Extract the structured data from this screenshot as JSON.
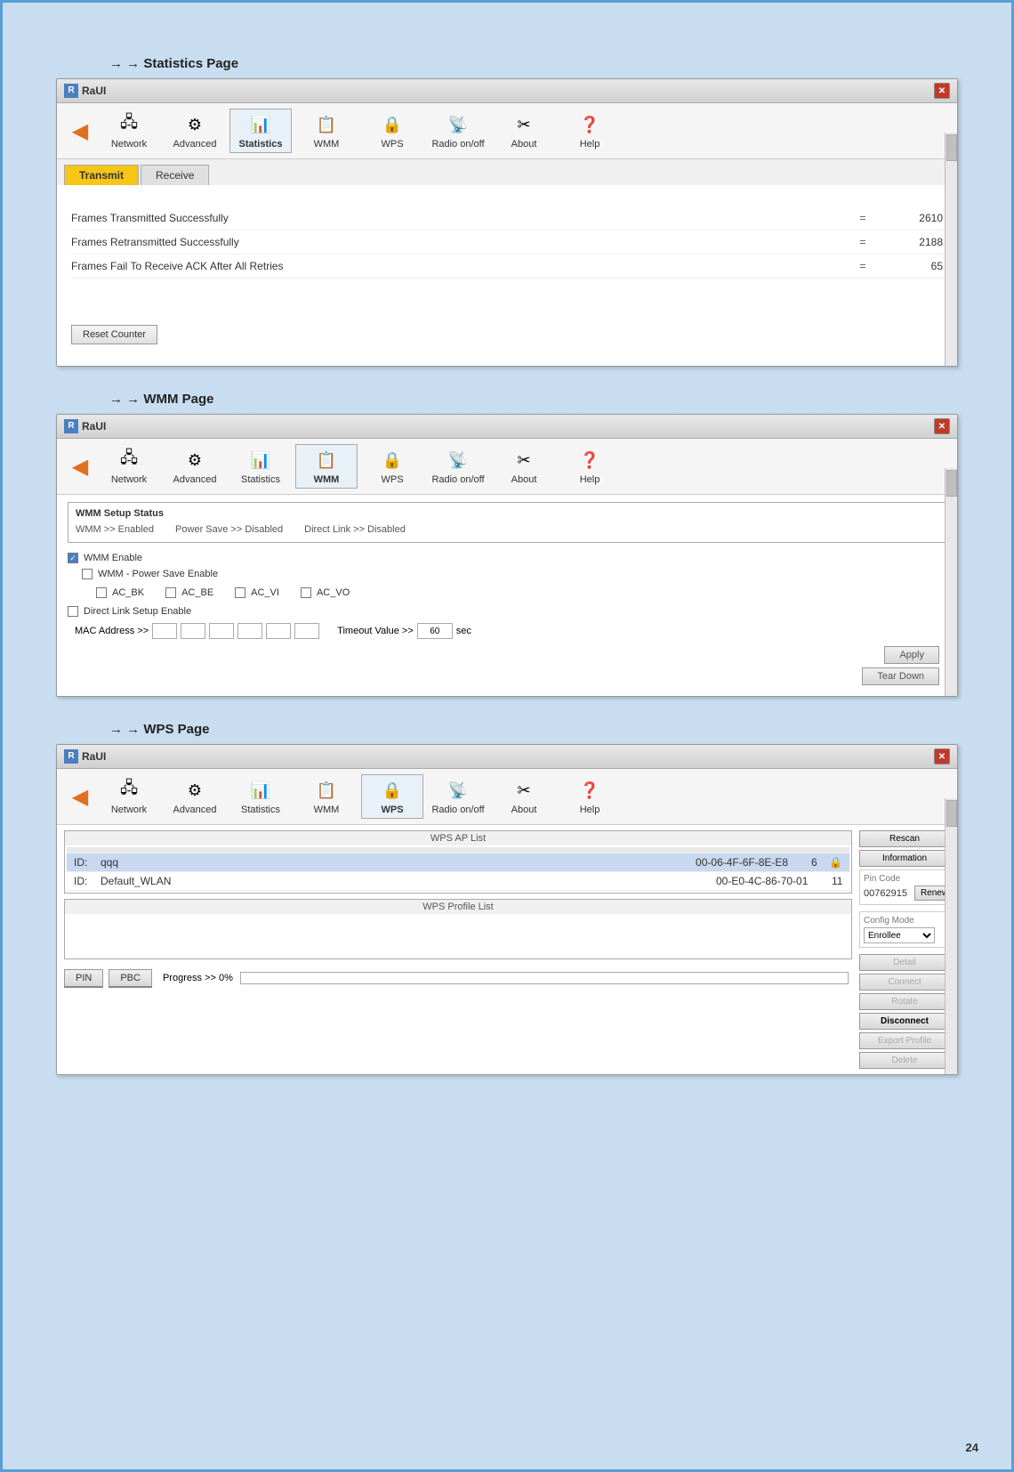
{
  "page": {
    "number": "24",
    "background_color": "#c8ddf0"
  },
  "sections": [
    {
      "id": "statistics",
      "header": "→ Statistics Page",
      "window": {
        "title": "RaUI",
        "tabs": [
          "Transmit",
          "Receive"
        ],
        "active_tab": "Transmit",
        "stats": [
          {
            "label": "Frames Transmitted Successfully",
            "eq": "=",
            "value": "2610"
          },
          {
            "label": "Frames Retransmitted Successfully",
            "eq": "=",
            "value": "2188"
          },
          {
            "label": "Frames Fail To Receive ACK After All Retries",
            "eq": "=",
            "value": "65"
          }
        ],
        "reset_btn": "Reset Counter"
      }
    },
    {
      "id": "wmm",
      "header": "→ WMM Page",
      "window": {
        "title": "RaUI",
        "wmm_status": {
          "enabled": "WMM >> Enabled",
          "power_save": "Power Save >> Disabled",
          "direct_link": "Direct Link >> Disabled"
        },
        "wmm_enable_label": "WMM Enable",
        "wmm_power_save_label": "WMM - Power Save Enable",
        "ac_options": [
          "AC_BK",
          "AC_BE",
          "AC_VI",
          "AC_VO"
        ],
        "direct_link_label": "Direct Link Setup Enable",
        "mac_label": "MAC Address >>",
        "timeout_label": "Timeout Value >>",
        "timeout_value": "60",
        "timeout_unit": "sec",
        "apply_btn": "Apply",
        "tear_down_btn": "Tear Down"
      }
    },
    {
      "id": "wps",
      "header": "→ WPS Page",
      "window": {
        "title": "RaUI",
        "ap_list_title": "WPS AP List",
        "ap_rows": [
          {
            "id_label": "ID:",
            "name": "qqq",
            "mac": "00-06-4F-6F-8E-E8",
            "channel": "6"
          },
          {
            "id_label": "ID:",
            "name": "Default_WLAN",
            "mac": "00-E0-4C-86-70-01",
            "channel": "11"
          }
        ],
        "profile_list_title": "WPS Profile List",
        "right_buttons": [
          "Rescan",
          "Information"
        ],
        "pin_code_label": "Pin Code",
        "pin_code_value": "00762915",
        "renew_btn": "Renew",
        "config_mode_label": "Config Mode",
        "config_mode_value": "Enrollee",
        "action_buttons": [
          "Detail",
          "Connect",
          "Rotate",
          "Disconnect",
          "Export Profile",
          "Delete"
        ],
        "pin_btn": "PIN",
        "pbc_btn": "PBC",
        "progress_label": "Progress >> 0%"
      }
    }
  ],
  "toolbar": {
    "items": [
      {
        "id": "network",
        "label": "Network",
        "icon": "🖧"
      },
      {
        "id": "advanced",
        "label": "Advanced",
        "icon": "⚙"
      },
      {
        "id": "statistics",
        "label": "Statistics",
        "icon": "📊"
      },
      {
        "id": "wmm",
        "label": "WMM",
        "icon": "📋"
      },
      {
        "id": "wps",
        "label": "WPS",
        "icon": "🔒"
      },
      {
        "id": "radio",
        "label": "Radio on/off",
        "icon": "📡"
      },
      {
        "id": "about",
        "label": "About",
        "icon": "✂"
      },
      {
        "id": "help",
        "label": "Help",
        "icon": "❓"
      }
    ]
  }
}
